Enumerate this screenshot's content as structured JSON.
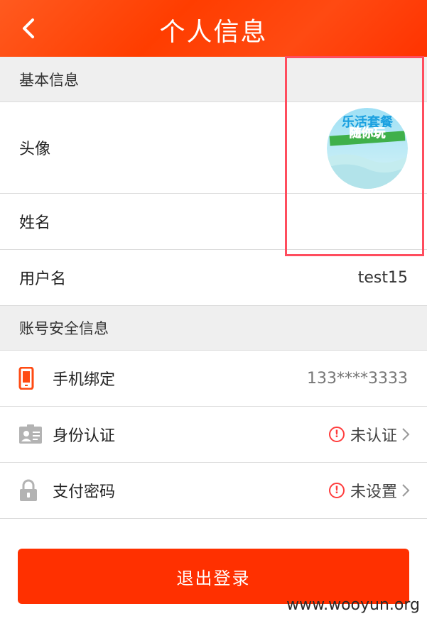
{
  "header": {
    "title": "个人信息",
    "back_icon": "chevron-left-icon",
    "background": "#ff4000"
  },
  "sections": {
    "basic": {
      "title": "基本信息"
    },
    "security": {
      "title": "账号安全信息"
    }
  },
  "basic_rows": {
    "avatar_label": "头像",
    "name_label": "姓名",
    "username_label": "用户名",
    "username_value": "test15"
  },
  "avatar_badge": {
    "line1": "乐活套餐",
    "line2": "随你玩"
  },
  "security_rows": {
    "phone": {
      "label": "手机绑定",
      "value": "133****3333",
      "icon": "phone-icon"
    },
    "identity": {
      "label": "身份认证",
      "status": "未认证",
      "icon": "id-card-icon"
    },
    "password": {
      "label": "支付密码",
      "status": "未设置",
      "icon": "lock-icon"
    }
  },
  "logout_button": {
    "label": "退出登录",
    "color": "#ff3000"
  },
  "watermark": "www.wooyun.org"
}
